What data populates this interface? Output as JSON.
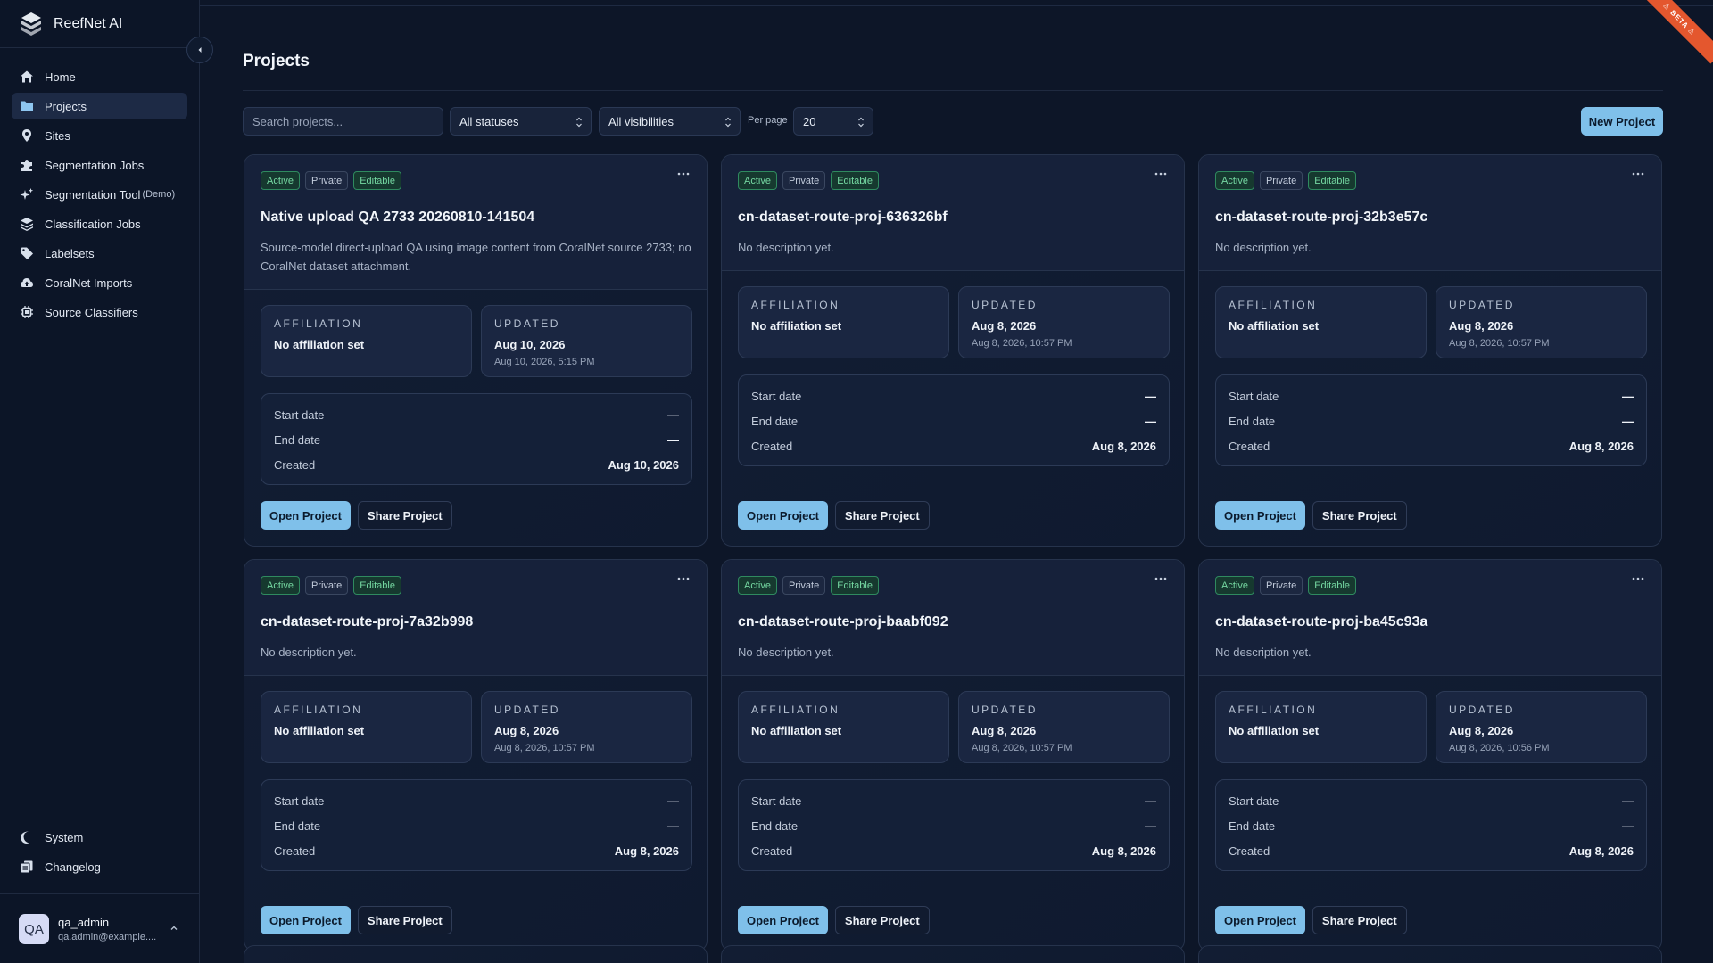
{
  "app": {
    "name": "ReefNet AI",
    "beta_label": "⚠ BETA ⚠"
  },
  "sidebar": {
    "items": [
      {
        "label": "Home",
        "icon": "home-icon"
      },
      {
        "label": "Projects",
        "icon": "folder-icon",
        "active": true
      },
      {
        "label": "Sites",
        "icon": "map-pin-icon"
      },
      {
        "label": "Segmentation Jobs",
        "icon": "puzzle-icon"
      },
      {
        "label": "Segmentation Tool",
        "suffix": "(Demo)",
        "icon": "sparkles-icon"
      },
      {
        "label": "Classification Jobs",
        "icon": "layers-icon"
      },
      {
        "label": "Labelsets",
        "icon": "tag-icon"
      },
      {
        "label": "CoralNet Imports",
        "icon": "cloud-upload-icon"
      },
      {
        "label": "Source Classifiers",
        "icon": "chip-icon"
      }
    ],
    "bottom": [
      {
        "label": "System",
        "icon": "moon-icon"
      },
      {
        "label": "Changelog",
        "icon": "changelog-icon"
      }
    ],
    "user": {
      "initials": "QA",
      "name": "qa_admin",
      "email": "qa.admin@example...."
    }
  },
  "main": {
    "title": "Projects",
    "search_placeholder": "Search projects...",
    "status_filter": "All statuses",
    "visibility_filter": "All visibilities",
    "per_page_label": "Per page",
    "per_page_value": "20",
    "new_project_label": "New Project"
  },
  "labels": {
    "affiliation": "AFFILIATION",
    "updated": "UPDATED",
    "start_date": "Start date",
    "end_date": "End date",
    "created": "Created",
    "open": "Open Project",
    "share": "Share Project"
  },
  "projects": [
    {
      "badges": [
        "Active",
        "Private",
        "Editable"
      ],
      "name": "Native upload QA 2733 20260810-141504",
      "description": "Source-model direct-upload QA using image content from CoralNet source 2733; no CoralNet dataset attachment.",
      "affiliation": "No affiliation set",
      "updated": "Aug 10, 2026",
      "updated_full": "Aug 10, 2026, 5:15 PM",
      "start_date": "—",
      "end_date": "—",
      "created": "Aug 10, 2026"
    },
    {
      "badges": [
        "Active",
        "Private",
        "Editable"
      ],
      "name": "cn-dataset-route-proj-636326bf",
      "description": "No description yet.",
      "affiliation": "No affiliation set",
      "updated": "Aug 8, 2026",
      "updated_full": "Aug 8, 2026, 10:57 PM",
      "start_date": "—",
      "end_date": "—",
      "created": "Aug 8, 2026"
    },
    {
      "badges": [
        "Active",
        "Private",
        "Editable"
      ],
      "name": "cn-dataset-route-proj-32b3e57c",
      "description": "No description yet.",
      "affiliation": "No affiliation set",
      "updated": "Aug 8, 2026",
      "updated_full": "Aug 8, 2026, 10:57 PM",
      "start_date": "—",
      "end_date": "—",
      "created": "Aug 8, 2026"
    },
    {
      "badges": [
        "Active",
        "Private",
        "Editable"
      ],
      "name": "cn-dataset-route-proj-7a32b998",
      "description": "No description yet.",
      "affiliation": "No affiliation set",
      "updated": "Aug 8, 2026",
      "updated_full": "Aug 8, 2026, 10:57 PM",
      "start_date": "—",
      "end_date": "—",
      "created": "Aug 8, 2026"
    },
    {
      "badges": [
        "Active",
        "Private",
        "Editable"
      ],
      "name": "cn-dataset-route-proj-baabf092",
      "description": "No description yet.",
      "affiliation": "No affiliation set",
      "updated": "Aug 8, 2026",
      "updated_full": "Aug 8, 2026, 10:57 PM",
      "start_date": "—",
      "end_date": "—",
      "created": "Aug 8, 2026"
    },
    {
      "badges": [
        "Active",
        "Private",
        "Editable"
      ],
      "name": "cn-dataset-route-proj-ba45c93a",
      "description": "No description yet.",
      "affiliation": "No affiliation set",
      "updated": "Aug 8, 2026",
      "updated_full": "Aug 8, 2026, 10:56 PM",
      "start_date": "—",
      "end_date": "—",
      "created": "Aug 8, 2026"
    }
  ]
}
